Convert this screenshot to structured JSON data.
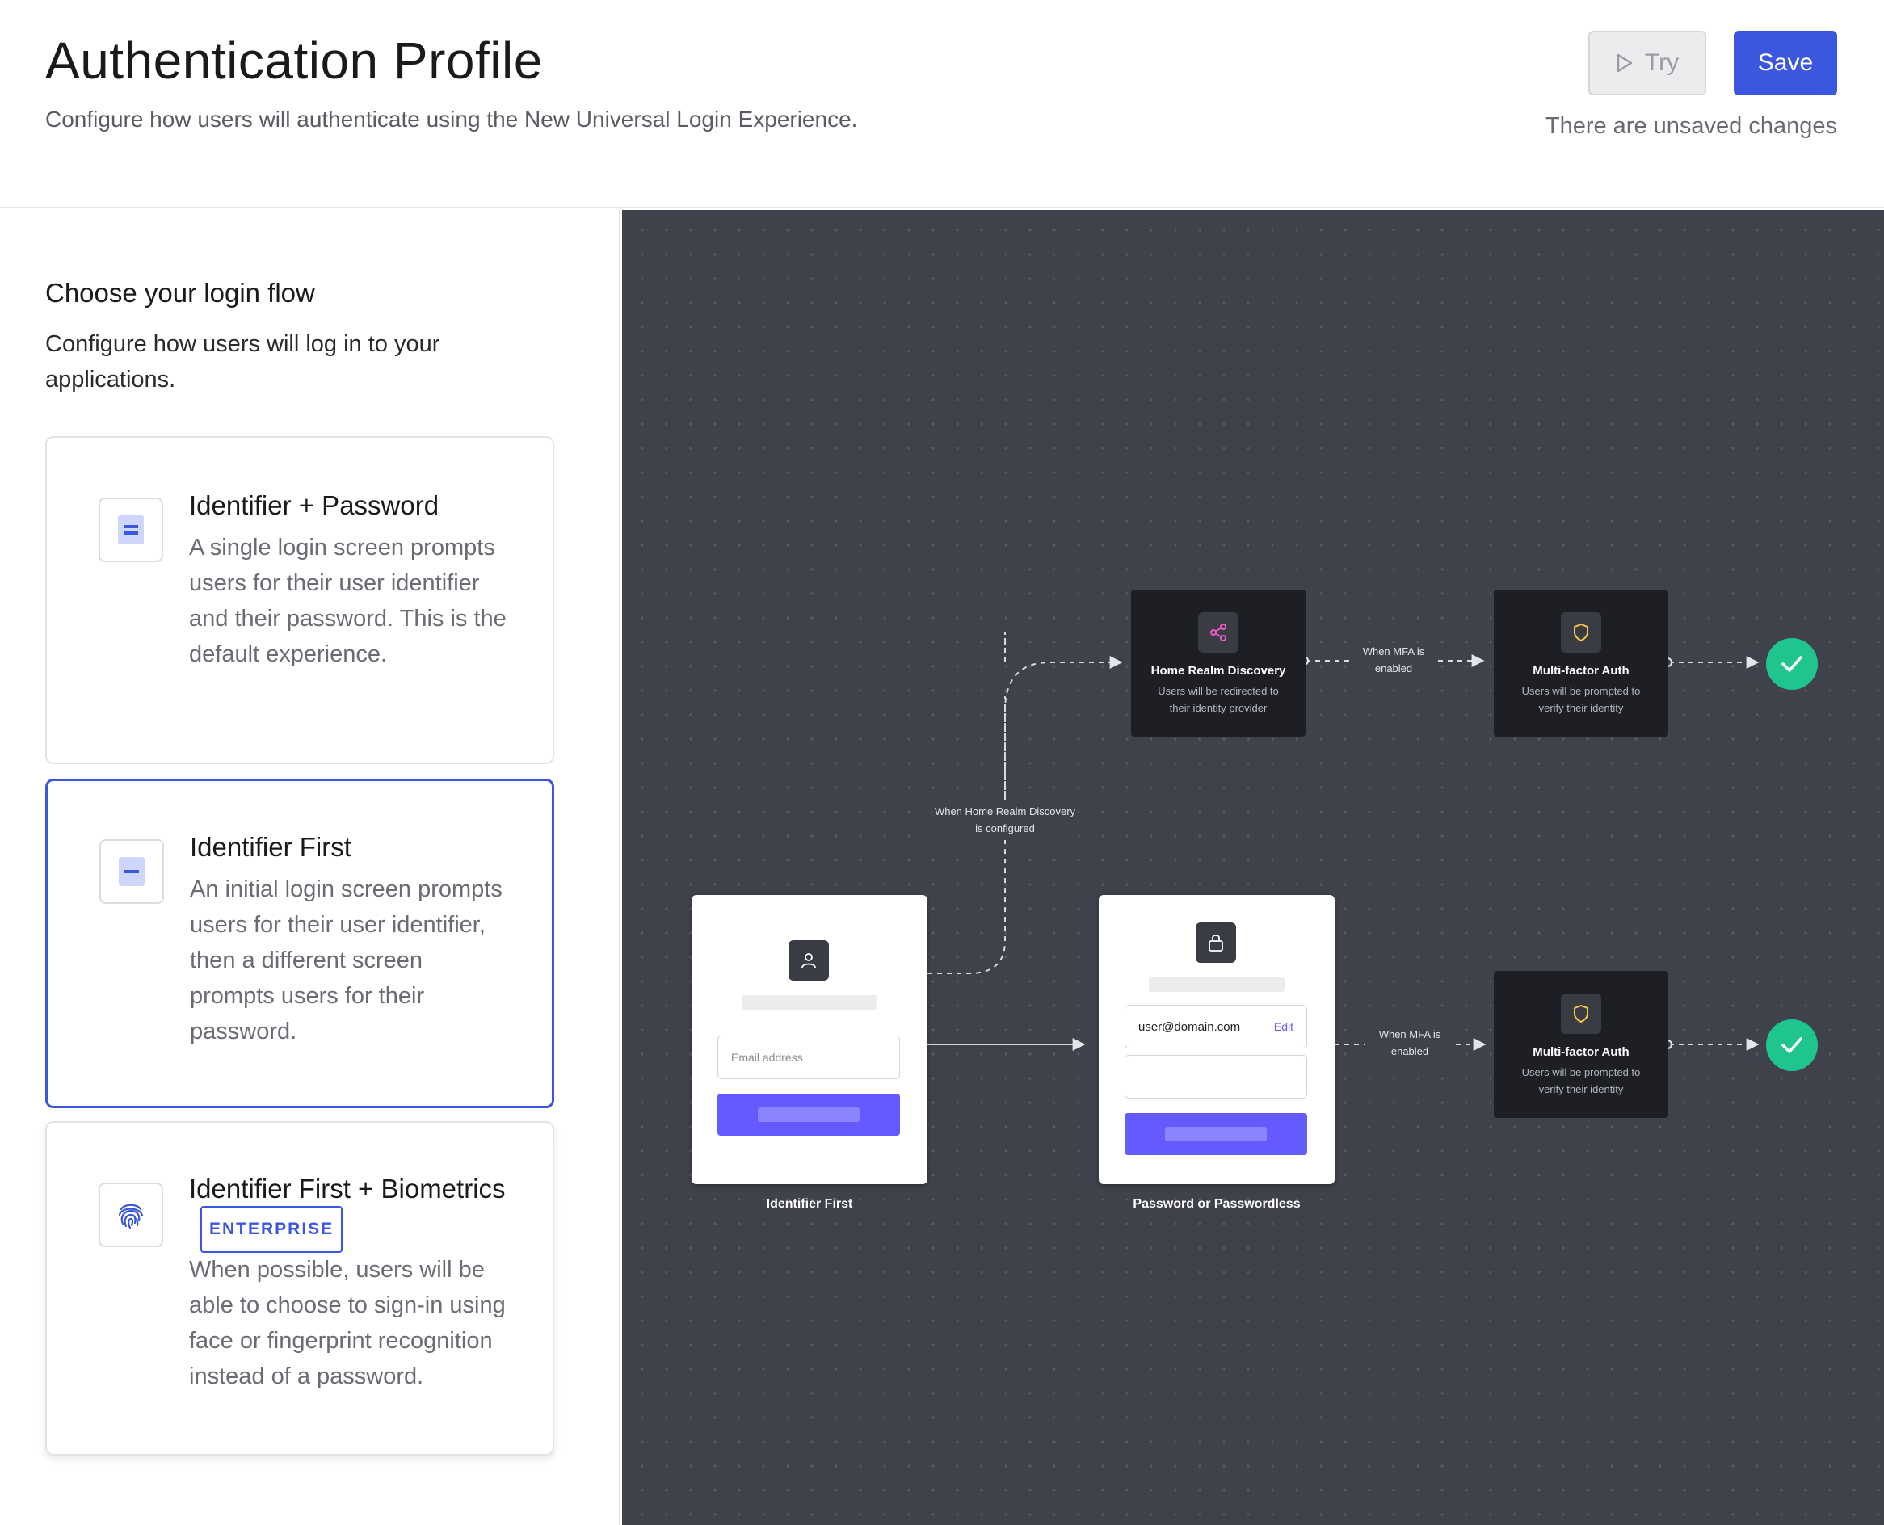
{
  "header": {
    "title": "Authentication Profile",
    "subtitle": "Configure how users will authenticate using the New Universal Login Experience.",
    "try_label": "Try",
    "save_label": "Save",
    "unsaved_text": "There are unsaved changes"
  },
  "sidebar": {
    "heading": "Choose your login flow",
    "description": "Configure how users will log in to your applications.",
    "selected_option": "Identifier First",
    "options": [
      {
        "icon": "password-form-icon",
        "title": "Identifier + Password",
        "description": "A single login screen prompts users for their user identifier and their password. This is the default experience."
      },
      {
        "icon": "identifier-form-icon",
        "title": "Identifier First",
        "description": "An initial login screen prompts users for their user identifier, then a different screen prompts users for their password."
      },
      {
        "icon": "fingerprint-icon",
        "title": "Identifier First + Biometrics",
        "badge": "ENTERPRISE",
        "description": "When possible, users will be able to choose to sign-in using face or fingerprint recognition instead of a password."
      }
    ]
  },
  "diagram": {
    "home_realm": {
      "icon": "share-icon",
      "title": "Home Realm Discovery",
      "description": "Users will be redirected to their identity provider"
    },
    "mfa_top": {
      "icon": "shield-icon",
      "title": "Multi-factor Auth",
      "description": "Users will be prompted to verify their identity"
    },
    "mfa_bottom": {
      "icon": "shield-icon",
      "title": "Multi-factor Auth",
      "description": "Users will be prompted to verify their identity"
    },
    "edge_mfa_top": "When MFA is enabled",
    "edge_mfa_bottom": "When MFA is enabled",
    "edge_hrd": "When Home Realm Discovery is configured",
    "identifier_screen": {
      "caption": "Identifier First",
      "email_placeholder": "Email address"
    },
    "password_screen": {
      "caption": "Password or Passwordless",
      "email_value": "user@domain.com",
      "edit_label": "Edit"
    },
    "colors": {
      "canvas": "#3f424b",
      "node": "#1e1f24",
      "accent": "#635bff",
      "success": "#1fc48e",
      "shield": "#f5c94a",
      "share": "#e85bc8"
    }
  }
}
